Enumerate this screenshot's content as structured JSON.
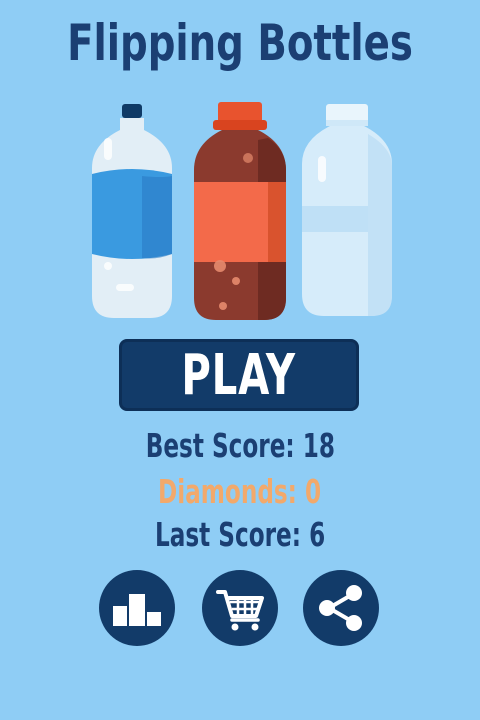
{
  "title": "Flipping Bottles",
  "play_label": "PLAY",
  "stats": {
    "best": "Best Score: 18",
    "diamonds": "Diamonds: 0",
    "last": "Last Score: 6"
  },
  "bottles": [
    {
      "name": "water-bottle",
      "cap": "#0f3a66",
      "liquid": "#3a9ae0",
      "body": "#e2eef6"
    },
    {
      "name": "cola-bottle",
      "cap": "#e8532e",
      "liquid": "#8b3a2e",
      "label": "#f36a4a"
    },
    {
      "name": "empty-bottle",
      "cap": "#e9f5fc",
      "body": "#d6ecfa"
    }
  ],
  "buttons": [
    {
      "name": "leaderboard-button",
      "icon": "leaderboard-icon"
    },
    {
      "name": "shop-button",
      "icon": "cart-icon"
    },
    {
      "name": "share-button",
      "icon": "share-icon"
    }
  ],
  "colors": {
    "background": "#8fcdf5",
    "primary": "#123b69",
    "title_text": "#1b3f73",
    "diamonds_text": "#f2a96b"
  }
}
